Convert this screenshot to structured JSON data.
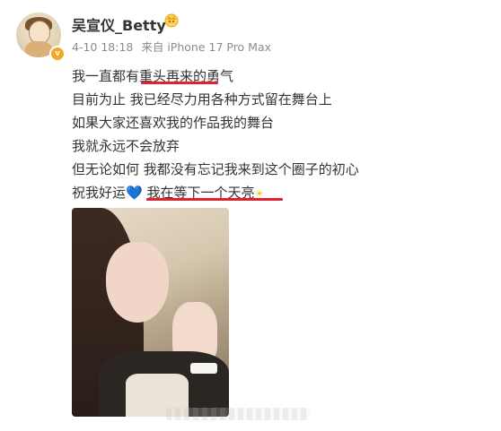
{
  "post": {
    "username": "吴宣仪_Betty",
    "date": "4-10 18:18",
    "source": "来自 iPhone 17 Pro Max",
    "lines": [
      "我一直都有重头再来的勇气",
      "目前为止 我已经尽力用各种方式留在舞台上",
      "如果大家还喜欢我的作品我的舞台",
      "我就永远不会放弃",
      "但无论如何 我都没有忘记我来到这个圈子的初心",
      "祝我好运"
    ],
    "line6_tail": "我在等下一个天亮",
    "heart_emoji": "💙",
    "sun_emoji": "☀"
  },
  "colors": {
    "underline": "#e0222e",
    "heart": "#1ab1c0",
    "badge": "#f5a623"
  },
  "icons": {
    "verified_badge": "vip-badge-icon",
    "crown": "crown-icon"
  }
}
